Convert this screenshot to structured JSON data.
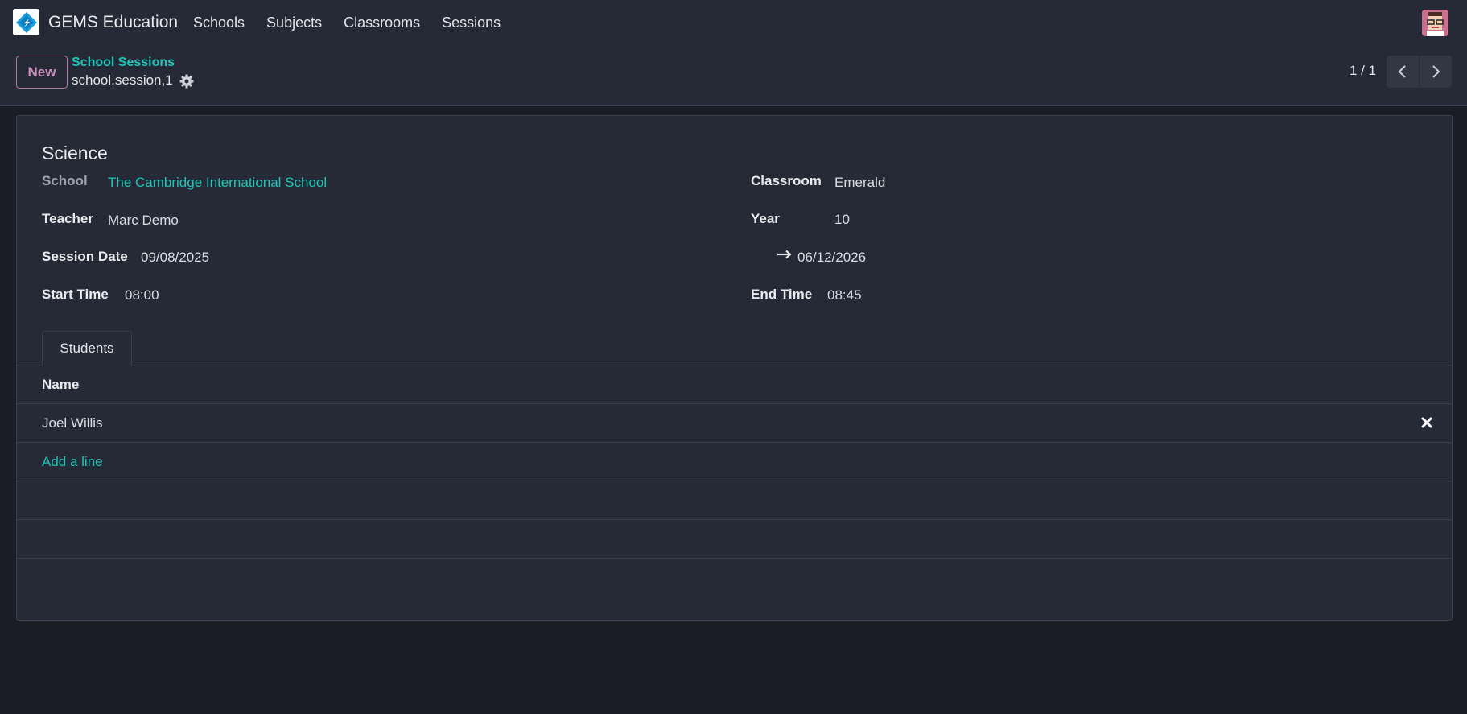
{
  "app": {
    "name": "GEMS Education",
    "menu": [
      "Schools",
      "Subjects",
      "Classrooms",
      "Sessions"
    ]
  },
  "control_panel": {
    "new_label": "New",
    "breadcrumb_parent": "School Sessions",
    "breadcrumb_current": "school.session,1",
    "pager_value": "1 / 1"
  },
  "record": {
    "title": "Science",
    "fields": {
      "school_label": "School",
      "school_value": "The Cambridge International School",
      "classroom_label": "Classroom",
      "classroom_value": "Emerald",
      "teacher_label": "Teacher",
      "teacher_value": "Marc Demo",
      "year_label": "Year",
      "year_value": "10",
      "session_date_label": "Session Date",
      "session_date_start": "09/08/2025",
      "session_date_end": "06/12/2026",
      "start_time_label": "Start Time",
      "start_time_value": "08:00",
      "end_time_label": "End Time",
      "end_time_value": "08:45"
    }
  },
  "tabs": {
    "students_label": "Students"
  },
  "students_list": {
    "column_name": "Name",
    "rows": [
      "Joel Willis"
    ],
    "add_line_label": "Add a line"
  },
  "colors": {
    "accent_teal": "#1ec5b6",
    "new_button": "#c690bb",
    "background": "#1b1d26",
    "panel": "#262a36"
  },
  "icons": {
    "app_logo": "gems-logo-icon",
    "settings": "gear-icon",
    "prev": "chevron-left-icon",
    "next": "chevron-right-icon",
    "date_range": "arrow-right-icon",
    "delete": "close-x-icon",
    "avatar": "user-avatar"
  }
}
